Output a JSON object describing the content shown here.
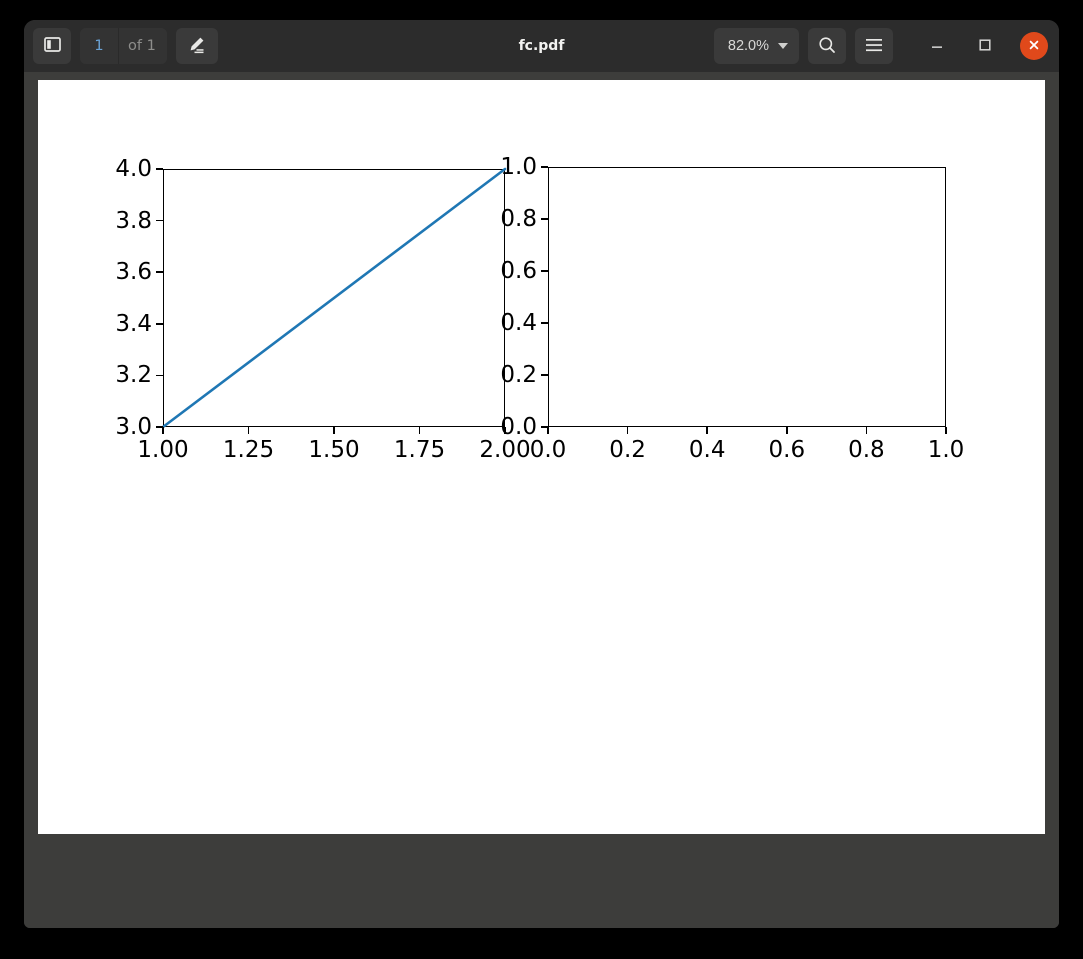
{
  "window": {
    "title": "fc.pdf",
    "titlebar": {
      "sidebar_toggle_name": "sidebar-toggle-icon",
      "page_number_value": "1",
      "page_count_label": "of 1",
      "annotate_icon": "pen-edit-icon",
      "zoom_level": "82.0%",
      "zoom_caret_icon": "chevron-down-icon",
      "search_icon": "search-icon",
      "menu_icon": "hamburger-menu-icon",
      "minimize_icon": "minimize-icon",
      "maximize_icon": "maximize-icon",
      "close_icon": "close-icon"
    },
    "colors": {
      "titlebar_bg": "#2c2c2c",
      "viewport_bg": "#3d3d3b",
      "page_bg": "#ffffff",
      "close_button": "#e0491b",
      "page_number_text": "#6ba3d6",
      "accent_line": "#1f77b4"
    }
  },
  "chart_data": [
    {
      "type": "line",
      "title": "",
      "xlabel": "",
      "ylabel": "",
      "xlim": [
        1.0,
        2.0
      ],
      "ylim": [
        3.0,
        4.0
      ],
      "xticks": [
        1.0,
        1.25,
        1.5,
        1.75,
        2.0
      ],
      "xticklabels": [
        "1.00",
        "1.25",
        "1.50",
        "1.75",
        "2.00"
      ],
      "yticks": [
        3.0,
        3.2,
        3.4,
        3.6,
        3.8,
        4.0
      ],
      "yticklabels": [
        "3.0",
        "3.2",
        "3.4",
        "3.6",
        "3.8",
        "4.0"
      ],
      "grid": false,
      "legend": null,
      "series": [
        {
          "name": "",
          "color": "#1f77b4",
          "linewidth": 2.6,
          "x": [
            1.0,
            2.0
          ],
          "y": [
            3.0,
            4.0
          ]
        }
      ]
    },
    {
      "type": "line",
      "title": "",
      "xlabel": "",
      "ylabel": "",
      "xlim": [
        0.0,
        1.0
      ],
      "ylim": [
        0.0,
        1.0
      ],
      "xticks": [
        0.0,
        0.2,
        0.4,
        0.6,
        0.8,
        1.0
      ],
      "xticklabels": [
        "0.0",
        "0.2",
        "0.4",
        "0.6",
        "0.8",
        "1.0"
      ],
      "yticks": [
        0.0,
        0.2,
        0.4,
        0.6,
        0.8,
        1.0
      ],
      "yticklabels": [
        "0.0",
        "0.2",
        "0.4",
        "0.6",
        "0.8",
        "1.0"
      ],
      "grid": false,
      "legend": null,
      "series": []
    }
  ]
}
